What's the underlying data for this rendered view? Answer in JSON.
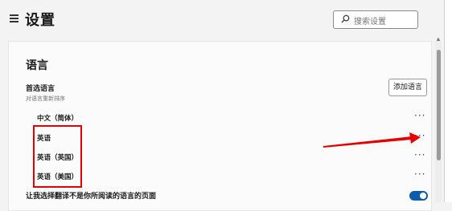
{
  "header": {
    "title": "设置",
    "search_placeholder": "搜索设置"
  },
  "language": {
    "section_title": "语言",
    "preferred_label": "首选语言",
    "preferred_sub": "对语言重新排序",
    "add_button": "添加语言",
    "languages": [
      {
        "name": "中文（简体）"
      },
      {
        "name": "英语"
      },
      {
        "name": "英语（英国）"
      },
      {
        "name": "英语（美国）"
      }
    ],
    "more_label": "···",
    "translate_label": "让我选择翻译不是你所阅读的语言的页面",
    "translate_enabled": true
  },
  "colors": {
    "accent": "#0b5cad",
    "highlight": "#e60000"
  }
}
